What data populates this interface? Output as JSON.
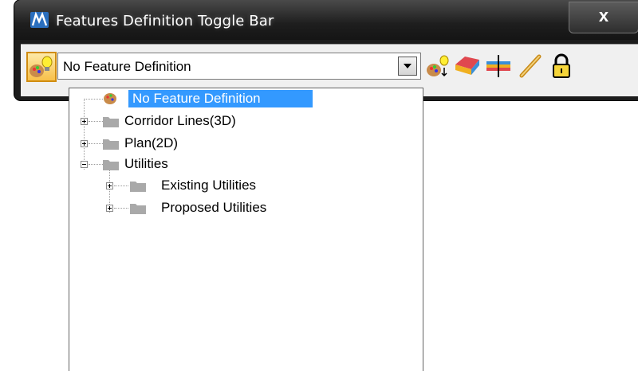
{
  "window": {
    "title": "Features Definition Toggle Bar",
    "close_label": "x"
  },
  "toolbar": {
    "combo_value": "No Feature Definition",
    "icons": [
      "feature-toggle-icon",
      "feature-edit-icon",
      "surface-icon",
      "profile-icon",
      "link-icon",
      "lock-icon"
    ]
  },
  "tree": {
    "items": [
      {
        "label": "No Feature Definition",
        "selected": true,
        "icon": "palette-icon"
      },
      {
        "label": "Corridor Lines(3D)",
        "expanded": false,
        "icon": "folder-icon"
      },
      {
        "label": "Plan(2D)",
        "expanded": false,
        "icon": "folder-icon"
      },
      {
        "label": "Utilities",
        "expanded": true,
        "icon": "folder-icon"
      },
      {
        "label": "Existing Utilities",
        "expanded": false,
        "icon": "folder-icon"
      },
      {
        "label": "Proposed Utilities",
        "expanded": false,
        "icon": "folder-icon"
      }
    ]
  },
  "colors": {
    "selection": "#3399ff",
    "title_bar": "#1e1e1e",
    "active_button": "#f7c04a"
  }
}
